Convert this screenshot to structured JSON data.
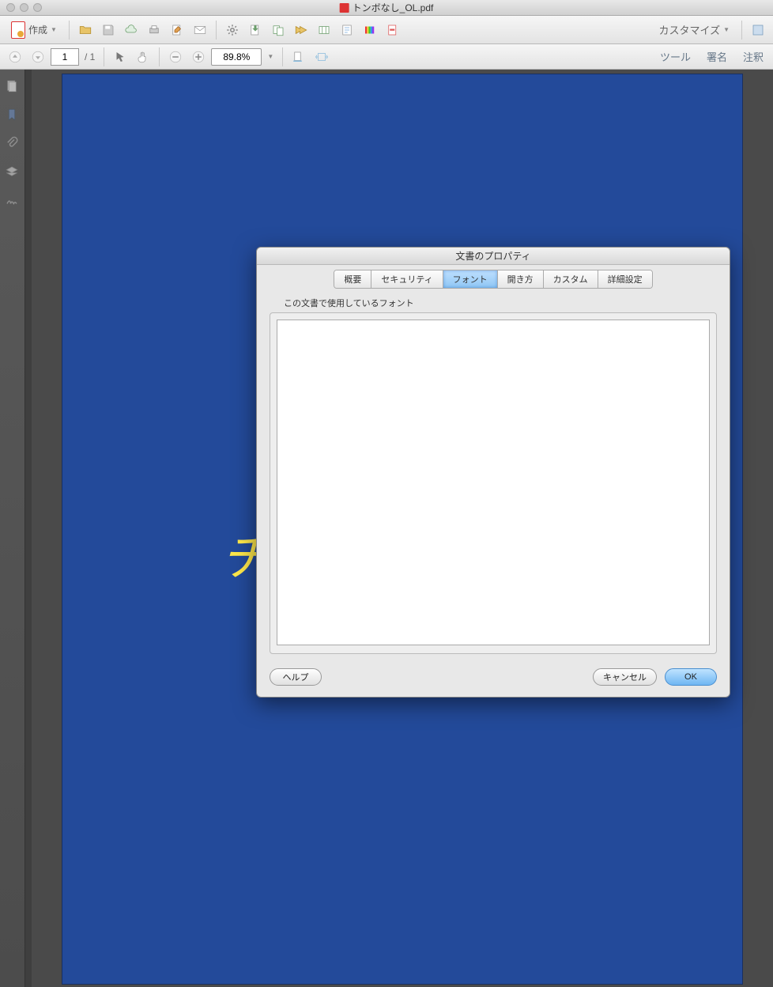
{
  "window": {
    "title": "トンボなし_OL.pdf"
  },
  "toolbar": {
    "create_label": "作成",
    "customize_label": "カスタマイズ"
  },
  "pagebar": {
    "current_page": "1",
    "page_separator": "/ 1",
    "zoom_value": "89.8%"
  },
  "rightlinks": {
    "tools": "ツール",
    "sign": "署名",
    "comment": "注釈"
  },
  "page": {
    "visible_char": "チ"
  },
  "dialog": {
    "title": "文書のプロパティ",
    "tabs": {
      "summary": "概要",
      "security": "セキュリティ",
      "fonts": "フォント",
      "initial": "開き方",
      "custom": "カスタム",
      "advanced": "詳細設定"
    },
    "fonts_section_label": "この文書で使用しているフォント",
    "buttons": {
      "help": "ヘルプ",
      "cancel": "キャンセル",
      "ok": "OK"
    }
  }
}
